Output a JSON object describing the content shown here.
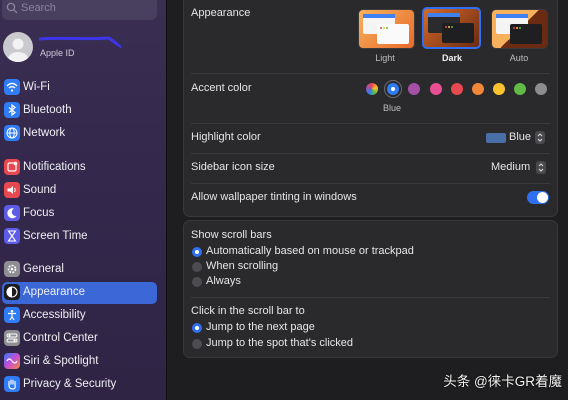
{
  "sidebar": {
    "search_placeholder": "Search",
    "account": {
      "subtitle": "Apple ID"
    },
    "items": [
      {
        "label": "Wi-Fi",
        "icon": "wifi-icon",
        "color": "#2f7cf6"
      },
      {
        "label": "Bluetooth",
        "icon": "bluetooth-icon",
        "color": "#2f7cf6"
      },
      {
        "label": "Network",
        "icon": "globe-icon",
        "color": "#2f7cf6"
      },
      {
        "label": "Notifications",
        "icon": "bell-icon",
        "color": "#e8484f"
      },
      {
        "label": "Sound",
        "icon": "speaker-icon",
        "color": "#e8484f"
      },
      {
        "label": "Focus",
        "icon": "moon-icon",
        "color": "#5e5ce6"
      },
      {
        "label": "Screen Time",
        "icon": "hourglass-icon",
        "color": "#5e5ce6"
      },
      {
        "label": "General",
        "icon": "gear-icon",
        "color": "#8e8e93"
      },
      {
        "label": "Appearance",
        "icon": "appearance-icon",
        "color": "#1c1c1e",
        "active": true
      },
      {
        "label": "Accessibility",
        "icon": "accessibility-icon",
        "color": "#2f7cf6"
      },
      {
        "label": "Control Center",
        "icon": "control-center-icon",
        "color": "#8e8e93"
      },
      {
        "label": "Siri & Spotlight",
        "icon": "siri-icon",
        "color": "#c84dd6"
      },
      {
        "label": "Privacy & Security",
        "icon": "hand-icon",
        "color": "#2f7cf6"
      }
    ]
  },
  "appearance": {
    "label": "Appearance",
    "options": [
      {
        "label": "Light",
        "selected": false
      },
      {
        "label": "Dark",
        "selected": true
      },
      {
        "label": "Auto",
        "selected": false
      }
    ]
  },
  "accent": {
    "label": "Accent color",
    "selected_name": "Blue",
    "colors": [
      "multicolor",
      "#2f7cf6",
      "#a550a7",
      "#e84f92",
      "#e8484f",
      "#f3883a",
      "#fbc12e",
      "#62ba46",
      "#8c8c8c"
    ],
    "selected_index": 1
  },
  "highlight": {
    "label": "Highlight color",
    "value": "Blue",
    "swatch": "#4a6ea8"
  },
  "sidebar_icon_size": {
    "label": "Sidebar icon size",
    "value": "Medium"
  },
  "wallpaper_tinting": {
    "label": "Allow wallpaper tinting in windows",
    "on": true,
    "accent": "#2f6ff0"
  },
  "scroll_bars": {
    "label": "Show scroll bars",
    "options": [
      {
        "label": "Automatically based on mouse or trackpad",
        "selected": true
      },
      {
        "label": "When scrolling",
        "selected": false
      },
      {
        "label": "Always",
        "selected": false
      }
    ]
  },
  "click_scroll": {
    "label": "Click in the scroll bar to",
    "options": [
      {
        "label": "Jump to the next page",
        "selected": true
      },
      {
        "label": "Jump to the spot that's clicked",
        "selected": false
      }
    ]
  },
  "watermark": "头条 @徕卡GR着魔"
}
